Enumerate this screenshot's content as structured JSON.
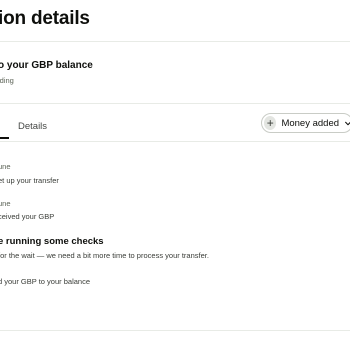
{
  "header": {
    "title": "ion details"
  },
  "summary": {
    "title": "o your GBP balance",
    "subtitle": "lding"
  },
  "tabs": {
    "first_label": "",
    "details_label": "Details"
  },
  "status_pill": {
    "icon": "plus-icon",
    "label": "Money added"
  },
  "timeline": {
    "step1_date": "une",
    "step1_text": "et up your transfer",
    "step2_date": "une",
    "step2_text": "ceived your GBP",
    "step3_heading": "e running some checks",
    "step3_text": "for the wait — we need a bit more time to process your transfer.",
    "step4_text": "d your GBP to your balance"
  }
}
